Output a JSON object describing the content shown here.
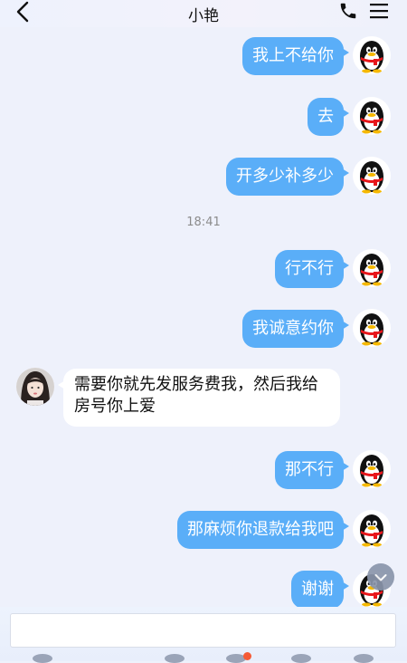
{
  "header": {
    "title": "小艳"
  },
  "messages": [
    {
      "text": "我上不给你"
    },
    {
      "text": "去"
    },
    {
      "text": "开多少补多少"
    },
    {
      "text": "行不行"
    },
    {
      "text": "我诚意约你"
    },
    {
      "text": "需要你就先发服务费我，然后我给房号你上爱"
    },
    {
      "text": "那不行"
    },
    {
      "text": "那麻烦你退款给我吧"
    },
    {
      "text": "谢谢"
    }
  ],
  "timestamp": "18:41",
  "input": {
    "value": "",
    "placeholder": ""
  },
  "colors": {
    "outgoing_bubble": "#5aaef8",
    "incoming_bubble": "#ffffff",
    "background": "#eef1fb"
  },
  "icons": {
    "back": "chevron-left-icon",
    "call": "phone-icon",
    "menu": "menu-icon",
    "scroll": "chevron-down-icon",
    "self_avatar": "penguin-avatar",
    "contact_avatar": "contact-avatar"
  }
}
